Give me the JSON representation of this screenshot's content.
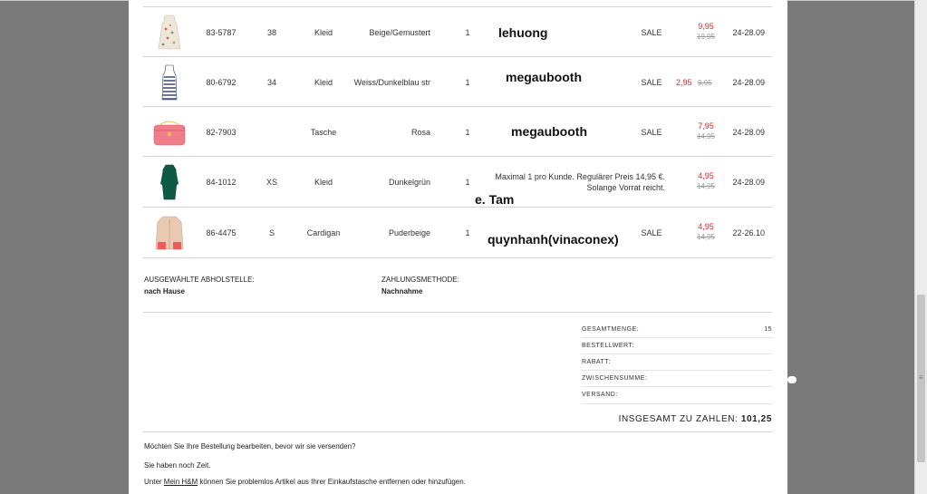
{
  "orders": [
    {
      "article": "83-5787",
      "size": "38",
      "type": "Kleid",
      "color": "Beige/Gemustert",
      "qty": "1",
      "overlay": "lehuong",
      "status": "SALE",
      "price_new": "9,95",
      "price_old": "19,95",
      "price_layout": "stacked",
      "delivery": "24-28.09",
      "thumb": "dress-print"
    },
    {
      "article": "80-6792",
      "size": "34",
      "type": "Kleid",
      "color": "Weiss/Dunkelblau str",
      "qty": "1",
      "overlay": "megaubooth",
      "status": "SALE",
      "price_new": "2,95",
      "price_old": "9,95",
      "price_layout": "inline",
      "delivery": "24-28.09",
      "thumb": "dress-stripe"
    },
    {
      "article": "82-7903",
      "size": "",
      "type": "Tasche",
      "color": "Rosa",
      "qty": "1",
      "overlay": "megaubooth",
      "status": "SALE",
      "price_new": "7,95",
      "price_old": "14,95",
      "price_layout": "stacked",
      "delivery": "24-28.09",
      "thumb": "bag-pink"
    },
    {
      "article": "84-1012",
      "size": "XS",
      "type": "Kleid",
      "color": "Dunkelgrün",
      "qty": "1",
      "overlay": "e. Tam",
      "status": "",
      "note_line1": "Maximal 1 pro Kunde. Regulärer Preis 14,95 €.",
      "note_line2": "Solange Vorrat reicht.",
      "price_new": "4,95",
      "price_old": "14,95",
      "price_layout": "stacked",
      "delivery": "24-28.09",
      "thumb": "dress-green"
    },
    {
      "article": "86-4475",
      "size": "S",
      "type": "Cardigan",
      "color": "Puderbeige",
      "qty": "1",
      "overlay": "quynhanh(vinaconex)",
      "status": "SALE",
      "price_new": "4,95",
      "price_old": "14,95",
      "price_layout": "stacked",
      "delivery": "22-26.10",
      "thumb": "cardigan"
    }
  ],
  "pickup": {
    "label": "AUSGEWÄHLTE ABHOLSTELLE:",
    "value": "nach Hause"
  },
  "payment": {
    "label": "ZAHLUNGSMETHODE:",
    "value": "Nachnahme"
  },
  "summary": {
    "rows": [
      {
        "label": "GESAMTMENGE:",
        "value": "15"
      },
      {
        "label": "BESTELLWERT:",
        "value": ""
      },
      {
        "label": "RABATT:",
        "value": ""
      },
      {
        "label": "ZWISCHENSUMME:",
        "value": ""
      },
      {
        "label": "VERSAND:",
        "value": ""
      }
    ],
    "total_label": "INSGESAMT ZU ZAHLEN:",
    "total_value": "101,25"
  },
  "messages": {
    "question": "Möchten Sie Ihre Bestellung bearbeiten, bevor wir sie versenden?",
    "time": "Sie haben noch Zeit.",
    "prefix": "Unter",
    "link": "Mein H&M",
    "suffix": "können Sie problemlos Artikel aus Ihrer Einkaufstasche entfernen oder hinzufügen."
  },
  "colors": {
    "sale_red": "#e22222",
    "page_bg": "#7a7a7a"
  }
}
